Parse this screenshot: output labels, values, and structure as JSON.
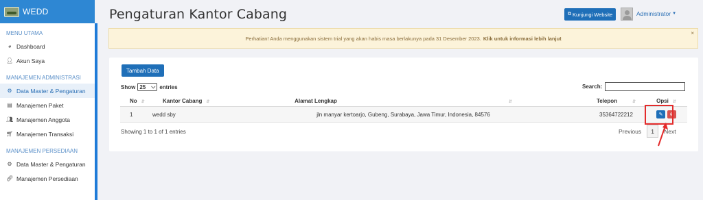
{
  "brand": {
    "name": "WEDD"
  },
  "sidebar": {
    "sections": [
      {
        "title": "MENU UTAMA",
        "items": [
          {
            "label": "Dashboard",
            "icon": "dashboard-icon"
          },
          {
            "label": "Akun Saya",
            "icon": "user-icon"
          }
        ]
      },
      {
        "title": "MANAJEMEN ADMINISTRASI",
        "items": [
          {
            "label": "Data Master & Pengaturan",
            "icon": "cogs-icon",
            "active": true
          },
          {
            "label": "Manajemen Paket",
            "icon": "book-icon"
          },
          {
            "label": "Manajemen Anggota",
            "icon": "users-icon"
          },
          {
            "label": "Manajemen Transaksi",
            "icon": "cart-icon"
          }
        ]
      },
      {
        "title": "MANAJEMEN PERSEDIAAN",
        "items": [
          {
            "label": "Data Master & Pengaturan",
            "icon": "cogs-icon"
          },
          {
            "label": "Manajemen Persediaan",
            "icon": "link-icon"
          }
        ]
      }
    ]
  },
  "header": {
    "title": "Pengaturan Kantor Cabang",
    "visit_button": "Kunjungi Website",
    "user": "Administrator"
  },
  "alert": {
    "text": "Perhatian! Anda menggunakan sistem trial yang akan habis masa berlakunya pada 31 Desember 2023.",
    "link": "Klik untuk informasi lebih lanjut",
    "close": "×"
  },
  "panel": {
    "add_button": "Tambah Data",
    "show_label": "Show",
    "entries_value": "25",
    "entries_label": "entries",
    "search_label": "Search:",
    "columns": [
      "No",
      "Kantor Cabang",
      "Alamat Lengkap",
      "Telepon",
      "Opsi"
    ],
    "rows": [
      {
        "no": "1",
        "kantor": "wedd sby",
        "alamat": "jln manyar kertoarjo, Gubeng, Surabaya, Jawa Timur, Indonesia, 84576",
        "telepon": "35364722212"
      }
    ],
    "info": "Showing 1 to 1 of 1 entries",
    "pagination": {
      "prev": "Previous",
      "page": "1",
      "next": "Next"
    }
  },
  "colors": {
    "brand_bar": "#2e87d3",
    "primary_button": "#1f6fb8",
    "delete_button": "#d9534f",
    "alert_bg": "#fcf3da",
    "annotation": "#e32b2b"
  }
}
